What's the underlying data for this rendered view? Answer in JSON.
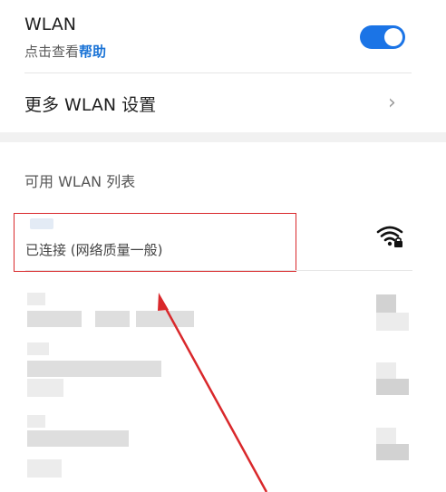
{
  "wlan": {
    "title": "WLAN",
    "subtitle_prefix": "点击查看",
    "subtitle_link": "帮助",
    "toggle_on": true
  },
  "more_settings": {
    "label": "更多 WLAN 设置",
    "chevron": "›"
  },
  "list": {
    "header": "可用 WLAN 列表",
    "connected": {
      "status": "已连接 (网络质量一般)",
      "icon": "wifi-lock-icon"
    }
  },
  "colors": {
    "accent": "#1b74e6",
    "link": "#1a73d6",
    "highlight": "#d9282b"
  }
}
